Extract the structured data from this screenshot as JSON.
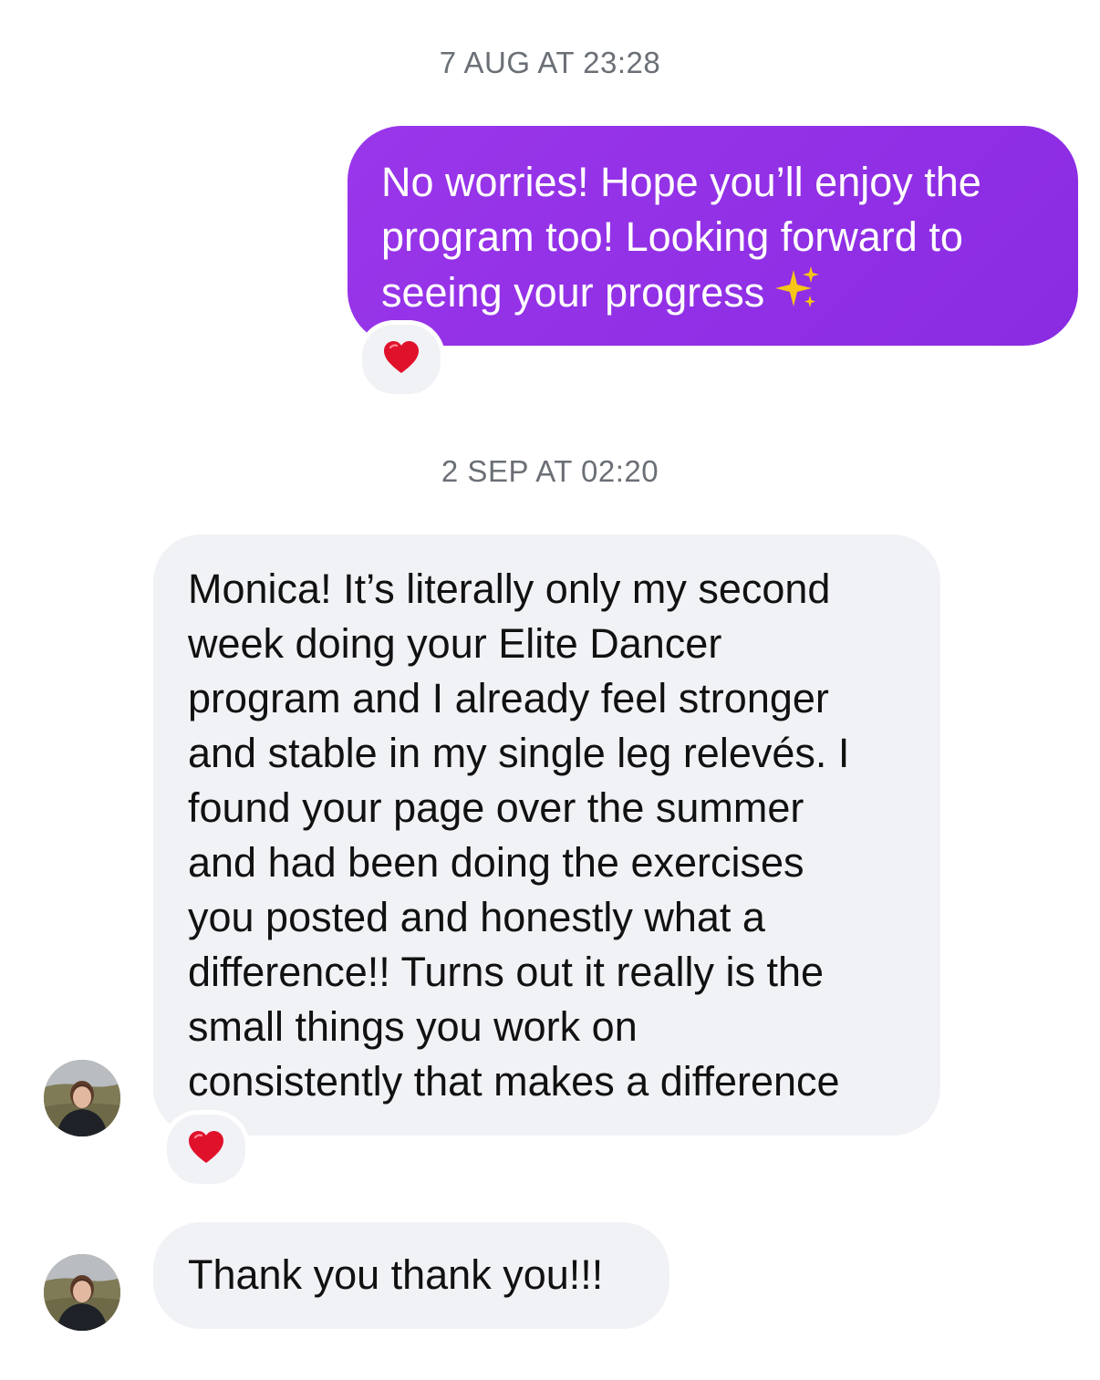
{
  "thread": {
    "timestamps": [
      "7 AUG AT 23:28",
      "2 SEP AT 02:20"
    ],
    "messages": [
      {
        "direction": "outgoing",
        "text": "No worries! Hope you’ll enjoy the\nprogram too! Looking forward to\nseeing your progress",
        "trailing_icon": "sparkles-icon",
        "reaction": "heart-icon"
      },
      {
        "direction": "incoming",
        "text": "Monica! It’s literally only my second\nweek doing your Elite Dancer\nprogram and I already feel stronger\nand stable in my single leg relevés. I\nfound your page over the summer\nand had been doing the exercises\nyou posted and honestly what a\ndifference!! Turns out it really is the\nsmall things you work on\nconsistently that makes a difference",
        "reaction": "heart-icon",
        "avatar": "user-avatar"
      },
      {
        "direction": "incoming",
        "text": "Thank you thank you!!!",
        "avatar": "user-avatar"
      }
    ]
  },
  "colors": {
    "outgoing_bubble": "#8f32e6",
    "incoming_bubble": "#f1f2f5",
    "timestamp_text": "#6b6f76",
    "heart": "#e0112b",
    "sparkle": "#f5c518"
  }
}
